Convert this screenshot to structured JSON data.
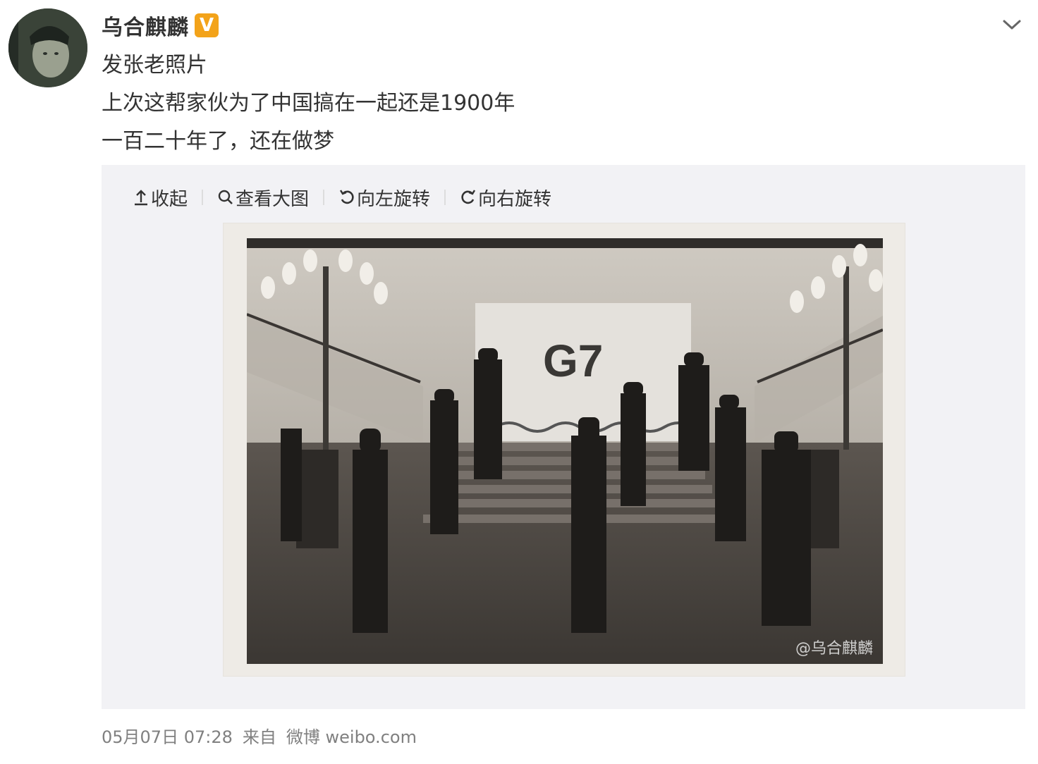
{
  "post": {
    "username": "乌合麒麟",
    "badge": "V",
    "lines": [
      "发张老照片",
      "上次这帮家伙为了中国搞在一起还是1900年",
      "一百二十年了，还在做梦"
    ]
  },
  "toolbar": {
    "collapse": "收起",
    "view_large": "查看大图",
    "rotate_left": "向左旋转",
    "rotate_right": "向右旋转"
  },
  "image": {
    "sign_text": "G7",
    "watermark": "@乌合麒麟"
  },
  "footer": {
    "date": "05月07日 07:28",
    "source_prefix": "来自",
    "source": "微博 weibo.com"
  },
  "icons": {
    "collapse": "upload-arrow-icon",
    "view_large": "search-icon",
    "rotate_left": "rotate-left-icon",
    "rotate_right": "rotate-right-icon",
    "menu": "chevron-down-icon"
  },
  "colors": {
    "badge": "#f3a31a",
    "media_bg": "#f2f2f5",
    "footer_text": "#808080"
  }
}
